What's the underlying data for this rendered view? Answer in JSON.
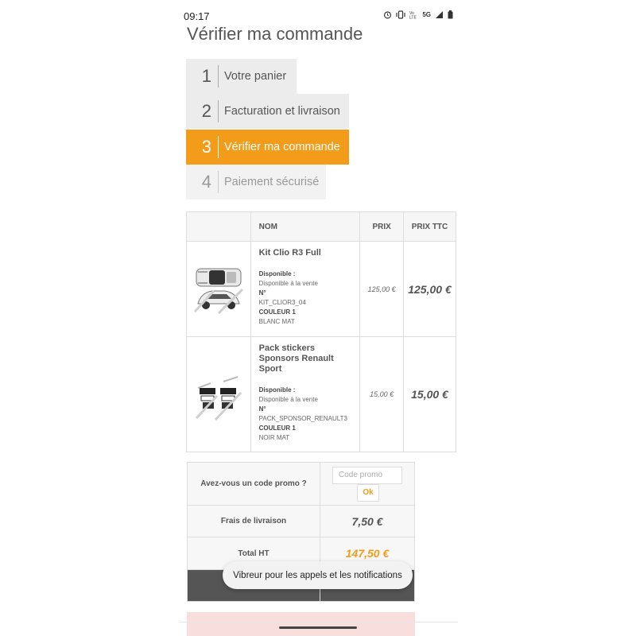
{
  "status_bar": {
    "time": "09:17",
    "icons": [
      "alarm-icon",
      "vibrate-icon",
      "volte-icon",
      "5g-icon",
      "signal-icon",
      "battery-icon"
    ],
    "network_label": "5G"
  },
  "page": {
    "title": "Vérifier ma commande"
  },
  "steps": [
    {
      "number": "1",
      "label": "Votre panier"
    },
    {
      "number": "2",
      "label": "Facturation et livraison"
    },
    {
      "number": "3",
      "label": "Vérifier ma commande"
    },
    {
      "number": "4",
      "label": "Paiement sécurisé"
    }
  ],
  "cart": {
    "headers": {
      "name": "NOM",
      "price": "PRIX",
      "price_ttc": "PRIX TTC"
    },
    "items": [
      {
        "name": "Kit Clio R3 Full",
        "availability_label": "Disponible :",
        "availability_value": "Disponible à la vente",
        "ref_label": "N°",
        "ref_value": "KIT_CLIOR3_04",
        "color_label": "COULEUR 1",
        "color_value": "BLANC MAT",
        "unit_price": "125,00 €",
        "total_price": "125,00 €",
        "image_icon": "car-stickers-image"
      },
      {
        "name": "Pack stickers Sponsors Renault Sport",
        "availability_label": "Disponible :",
        "availability_value": "Disponible à la vente",
        "ref_label": "N°",
        "ref_value": "PACK_SPONSOR_RENAULT3",
        "color_label": "COULEUR 1",
        "color_value": "NOIR MAT",
        "unit_price": "15,00 €",
        "total_price": "15,00 €",
        "image_icon": "sponsor-stickers-image"
      }
    ]
  },
  "summary": {
    "promo_label": "Avez-vous un code promo ?",
    "promo_placeholder": "Code promo",
    "promo_button": "Ok",
    "shipping_label": "Frais de livraison",
    "shipping_value": "7,50 €",
    "total_ht_label": "Total HT",
    "total_ht_value": "147,50 €"
  },
  "toast": {
    "text": "Vibreur pour les appels et les notifications"
  },
  "colors": {
    "accent": "#f39c19",
    "step_bg": "#ececec",
    "alert_bg": "#f9dede"
  }
}
